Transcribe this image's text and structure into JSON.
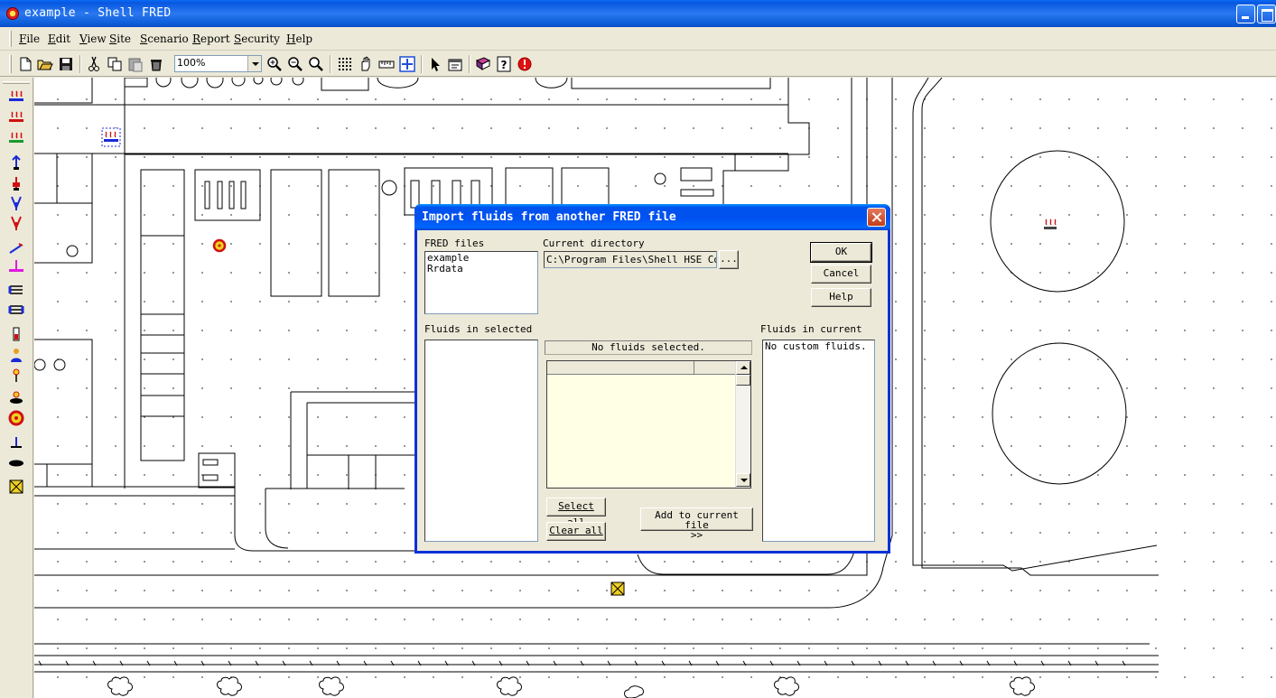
{
  "window": {
    "title": "example - Shell FRED"
  },
  "menu": [
    "File",
    "Edit",
    "View",
    "Site",
    "Scenario",
    "Report",
    "Security",
    "Help"
  ],
  "toolbar": {
    "zoom": "100%"
  },
  "dialog": {
    "title": "Import fluids from another FRED file",
    "fred_files_label": "FRED files",
    "fred_files": [
      "example",
      "Rrdata"
    ],
    "current_directory_label": "Current directory",
    "current_directory_value": "C:\\Program Files\\Shell HSE Cons",
    "browse_label": "...",
    "ok_label": "OK",
    "cancel_label": "Cancel",
    "help_label": "Help",
    "fluids_selected_label": "Fluids in selected",
    "no_fluids_label": "No fluids selected.",
    "fluids_current_label": "Fluids in current",
    "current_fluids_text": "No custom fluids.",
    "select_all_label": "Select all",
    "clear_all_label": "Clear all",
    "add_line1": "Add to current file",
    "add_line2": ">>"
  },
  "colors": {
    "title_bar": "#0a5ad6",
    "dialog_border": "#0831d9",
    "grid_fill": "#ffffe6"
  }
}
